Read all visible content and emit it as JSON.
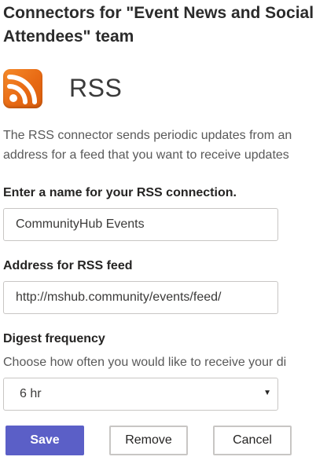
{
  "header": {
    "title_line1": "Connectors for \"Event News and Social",
    "title_line2": "Attendees\" team"
  },
  "connector": {
    "icon": "rss-icon",
    "icon_color": "#e8711c",
    "name": "RSS",
    "description_line1": "The RSS connector sends periodic updates from an",
    "description_line2": "address for a feed that you want to receive updates"
  },
  "form": {
    "name_label": "Enter a name for your RSS connection.",
    "name_value": "CommunityHub Events",
    "address_label": "Address for RSS feed",
    "address_value": "http://mshub.community/events/feed/",
    "digest_label": "Digest frequency",
    "digest_help": "Choose how often you would like to receive your di",
    "digest_value": "6 hr",
    "digest_caret": "▼"
  },
  "actions": {
    "save_label": "Save",
    "remove_label": "Remove",
    "cancel_label": "Cancel",
    "primary_color": "#5b5fc7"
  }
}
